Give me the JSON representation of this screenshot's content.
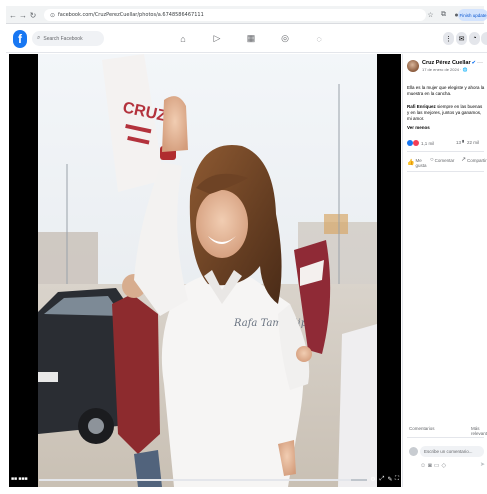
{
  "browser": {
    "url": "facebook.com/CruzPerezCuellar/photos/a.6748586467111",
    "finish_update": "Finish update"
  },
  "facebook": {
    "logo_letter": "f",
    "search_placeholder": "Search Facebook"
  },
  "photo": {
    "sign_letters": "CRUZ",
    "shirt_text": "Rafa Tamaulipas",
    "progress_percent": 95,
    "time": "■■ ■■■"
  },
  "post": {
    "author": "Cruz Pérez Cuellar",
    "meta": "17 de enero de 2024 · 🌐",
    "caption_1": "Ella es la mujer que elegiste y ahora la muestra en la cancha.",
    "caption_2_bold": "Rafi Enriquez",
    "caption_2": " siempre en las buenas y en las mejores, juntos ya ganamos, mi amor.",
    "see_more": "Ver menos",
    "reaction_count": "1,1 mil",
    "comments_count": "13",
    "shares_count": "22 mil",
    "like_label": "Me gusta",
    "comment_label": "Comentar",
    "share_label": "Compartir",
    "comments_header": "Comentarios",
    "most_relevant": "Más relevantes",
    "comment_placeholder": "Escribe un comentario..."
  }
}
